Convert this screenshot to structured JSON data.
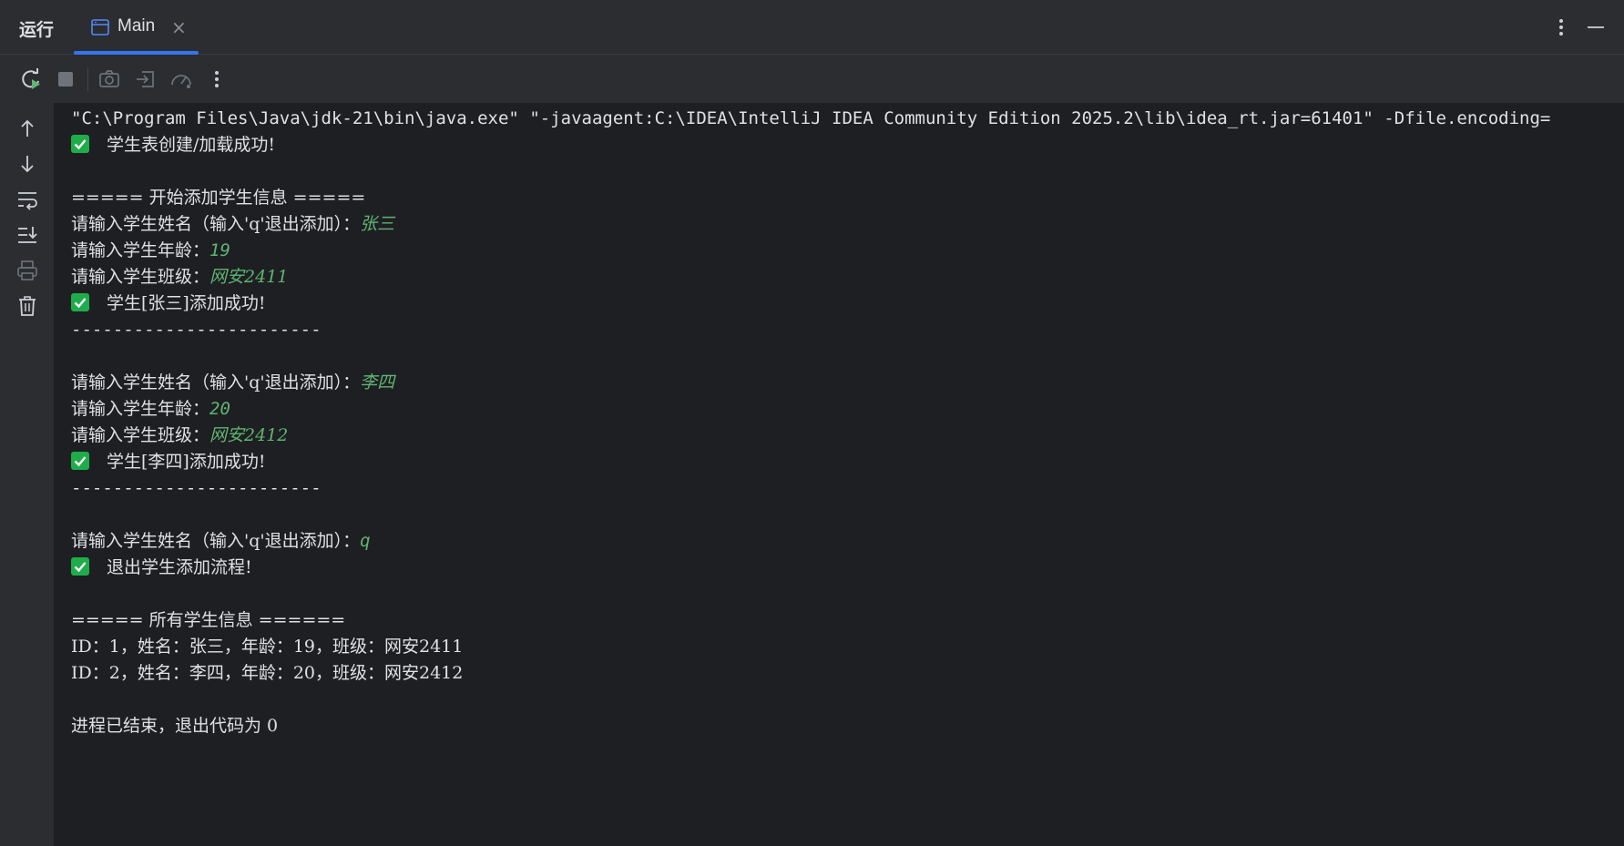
{
  "header": {
    "run_title": "运行",
    "tab_label": "Main",
    "tab_close": "×"
  },
  "console": {
    "cmd": "\"C:\\Program Files\\Java\\jdk-21\\bin\\java.exe\" \"-javaagent:C:\\IDEA\\IntelliJ IDEA Community Edition 2025.2\\lib\\idea_rt.jar=61401\" -Dfile.encoding=",
    "table_ok": "学生表创建/加载成功!",
    "add_header": "===== 开始添加学生信息 =====",
    "prompt_name": "请输入学生姓名（输入'q'退出添加）：",
    "prompt_age": "请输入学生年龄：",
    "prompt_class": "请输入学生班级：",
    "name1": "张三",
    "age1": "19",
    "class1": "网安2411",
    "added1": "学生[张三]添加成功!",
    "divider": "------------------------",
    "name2": "李四",
    "age2": "20",
    "class2": "网安2412",
    "added2": "学生[李四]添加成功!",
    "quit_input": "q",
    "exit_msg": "退出学生添加流程!",
    "all_header": "===== 所有学生信息 ======",
    "row1": "ID：1，姓名：张三，年龄：19，班级：网安2411",
    "row2": "ID：2，姓名：李四，年龄：20，班级：网安2412",
    "end_msg": "进程已结束，退出代码为 0"
  },
  "colors": {
    "accent": "#3574f0",
    "check_green": "#1fad4b",
    "input_green": "#5fb573",
    "panel_bg": "#2b2d30",
    "console_bg": "#1e1f22"
  },
  "icons": {
    "header": [
      "console-tab-icon",
      "close-icon",
      "more-vertical-icon",
      "minimize-icon"
    ],
    "toolbar": [
      "rerun-icon",
      "stop-icon",
      "screenshot-icon",
      "restore-layout-icon",
      "profiler-icon",
      "more-vertical-icon"
    ],
    "gutter": [
      "arrow-up-icon",
      "arrow-down-icon",
      "soft-wrap-icon",
      "scroll-to-end-icon",
      "print-icon",
      "trash-icon"
    ],
    "status": "check-icon"
  }
}
